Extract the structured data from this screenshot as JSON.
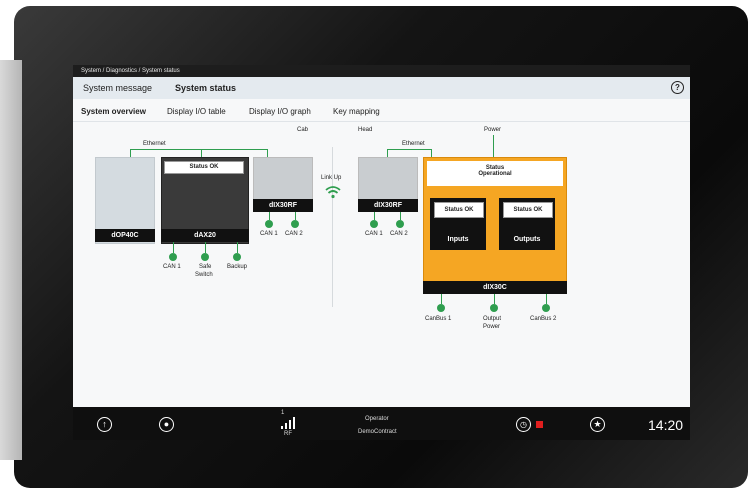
{
  "breadcrumb": "System / Diagnostics / System status",
  "header": {
    "system_message": "System message",
    "system_status": "System status",
    "help": "?"
  },
  "tabs": [
    "System overview",
    "Display I/O table",
    "Display I/O graph",
    "Key mapping"
  ],
  "diagram": {
    "cab": "Cab",
    "head": "Head",
    "ethernet_left": "Ethernet",
    "ethernet_right": "Ethernet",
    "power": "Power",
    "link_up": "Link Up",
    "dop40c": "dOP40C",
    "dax20": "dAX20",
    "dax20_status": "Status OK",
    "dax20_ports": [
      "CAN 1",
      "Safe",
      "Switch",
      "Backup"
    ],
    "dix30rf_left": "dIX30RF",
    "dix30rf_left_ports": [
      "CAN 1",
      "CAN 2"
    ],
    "dix30rf_right": "dIX30RF",
    "dix30rf_right_ports": [
      "CAN 1",
      "CAN 2"
    ],
    "dix30c": "dIX30C",
    "dix30c_status": "Status",
    "dix30c_status2": "Operational",
    "inputs_status": "Status OK",
    "inputs": "Inputs",
    "outputs_status": "Status OK",
    "outputs": "Outputs",
    "dix30c_ports": [
      "CanBus 1",
      "Output",
      "Power",
      "CanBus 2"
    ]
  },
  "taskbar": {
    "signal_num": "1",
    "rf": "RF",
    "operator": "Operator",
    "contract": "DemoContract",
    "time": "14:20"
  },
  "colors": {
    "accent": "#f5a623",
    "ok": "#2f9e4f"
  }
}
